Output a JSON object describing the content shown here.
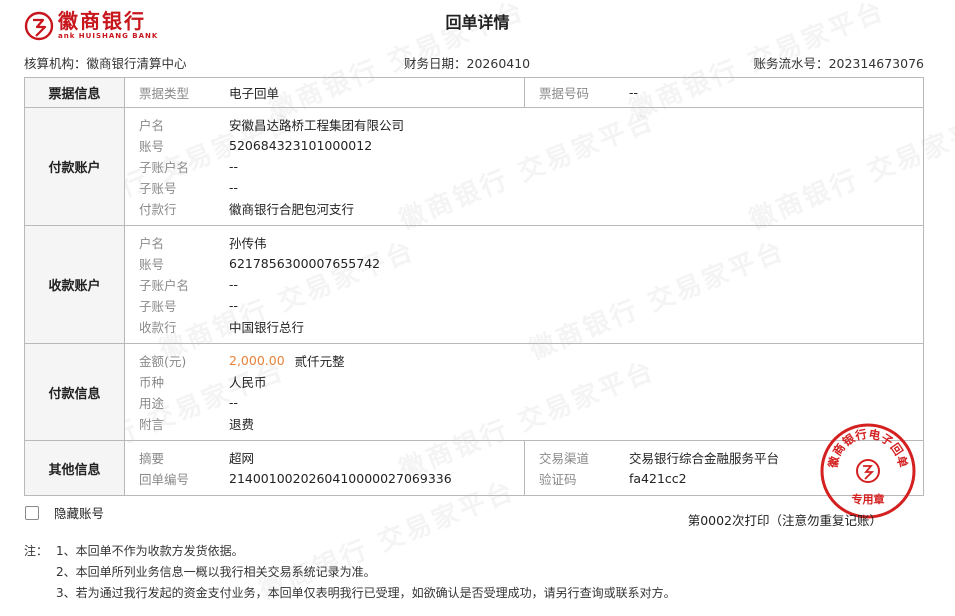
{
  "bank": {
    "name_cn": "徽商银行",
    "name_en": "ank HUISHANG BANK"
  },
  "page": {
    "title": "回单详情"
  },
  "meta": {
    "org_label": "核算机构：",
    "org_value": "徽商银行清算中心",
    "date_label": "财务日期：",
    "date_value": "20260410",
    "serial_label": "账务流水号：",
    "serial_value": "202314673076"
  },
  "ticket": {
    "section": "票据信息",
    "type_label": "票据类型",
    "type_value": "电子回单",
    "no_label": "票据号码",
    "no_value": "--"
  },
  "payer": {
    "section": "付款账户",
    "fields": [
      {
        "label": "户名",
        "value": "安徽昌达路桥工程集团有限公司"
      },
      {
        "label": "账号",
        "value": "520684323101000012"
      },
      {
        "label": "子账户名",
        "value": "--"
      },
      {
        "label": "子账号",
        "value": "--"
      },
      {
        "label": "付款行",
        "value": "徽商银行合肥包河支行"
      }
    ]
  },
  "payee": {
    "section": "收款账户",
    "fields": [
      {
        "label": "户名",
        "value": "孙传伟"
      },
      {
        "label": "账号",
        "value": "6217856300007655742"
      },
      {
        "label": "子账户名",
        "value": "--"
      },
      {
        "label": "子账号",
        "value": "--"
      },
      {
        "label": "收款行",
        "value": "中国银行总行"
      }
    ]
  },
  "payment": {
    "section": "付款信息",
    "amount_label": "金额(元)",
    "amount_value": "2,000.00",
    "amount_words": "贰仟元整",
    "fields": [
      {
        "label": "币种",
        "value": "人民币"
      },
      {
        "label": "用途",
        "value": "--"
      },
      {
        "label": "附言",
        "value": "退费"
      }
    ]
  },
  "other": {
    "section": "其他信息",
    "summary_label": "摘要",
    "summary_value": "超网",
    "receipt_no_label": "回单编号",
    "receipt_no_value": "2140010020260410000027069336",
    "channel_label": "交易渠道",
    "channel_value": "交易银行综合金融服务平台",
    "code_label": "验证码",
    "code_value": "fa421cc2"
  },
  "controls": {
    "hide_account_label": "隐藏账号",
    "print_note": "第0002次打印（注意勿重复记账）"
  },
  "notes": {
    "prefix": "注：",
    "items": [
      "1、本回单不作为收款方发货依据。",
      "2、本回单所列业务信息一概以我行相关交易系统记录为准。",
      "3、若为通过我行发起的资金支付业务，本回单仅表明我行已受理，如欲确认是否受理成功，请另行查询或联系对方。"
    ]
  },
  "stamp": {
    "text": "徽商银行电子回单",
    "sub": "专用章",
    "color": "#d42020"
  },
  "watermark_text": "徽商银行  交易家平台",
  "colors": {
    "brand": "#c8161d",
    "amount": "#e8833a"
  }
}
